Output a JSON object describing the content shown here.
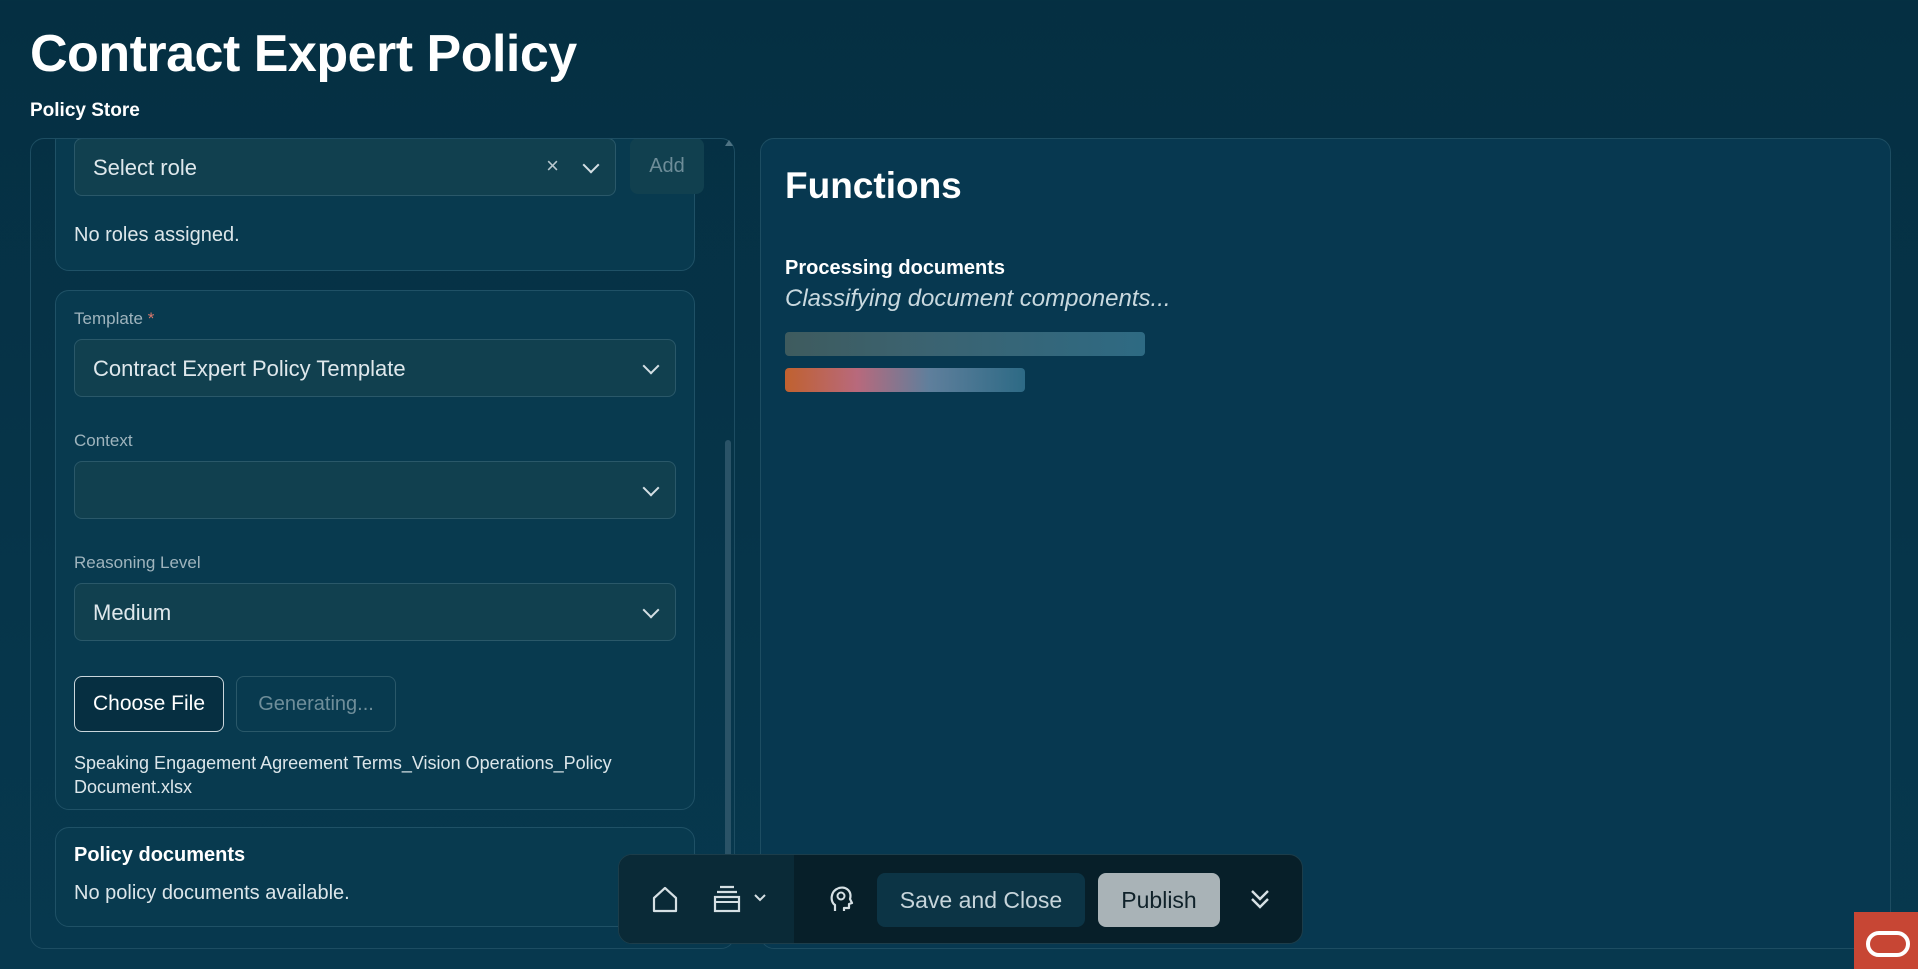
{
  "header": {
    "title": "Contract Expert Policy",
    "subtitle": "Policy Store"
  },
  "roles": {
    "select_placeholder": "Select role",
    "add_label": "Add",
    "empty_text": "No roles assigned."
  },
  "template_card": {
    "template_label": "Template",
    "required_marker": "*",
    "template_value": "Contract Expert Policy Template",
    "context_label": "Context",
    "context_value": "",
    "reasoning_label": "Reasoning Level",
    "reasoning_value": "Medium",
    "choose_file_label": "Choose File",
    "generating_label": "Generating...",
    "file_name": "Speaking Engagement Agreement Terms_Vision Operations_Policy Document.xlsx"
  },
  "policy_docs": {
    "title": "Policy documents",
    "empty_text": "No policy documents available."
  },
  "functions": {
    "title": "Functions",
    "processing_title": "Processing documents",
    "processing_status": "Classifying document components..."
  },
  "toolbar": {
    "save_label": "Save and Close",
    "publish_label": "Publish",
    "icons": [
      "home-icon",
      "layers-icon",
      "chevron-down-icon",
      "ai-assistant-icon",
      "collapse-icon"
    ]
  },
  "colors": {
    "background": "#052f42",
    "panel": "#073850",
    "accent_oracle": "#c74634"
  }
}
